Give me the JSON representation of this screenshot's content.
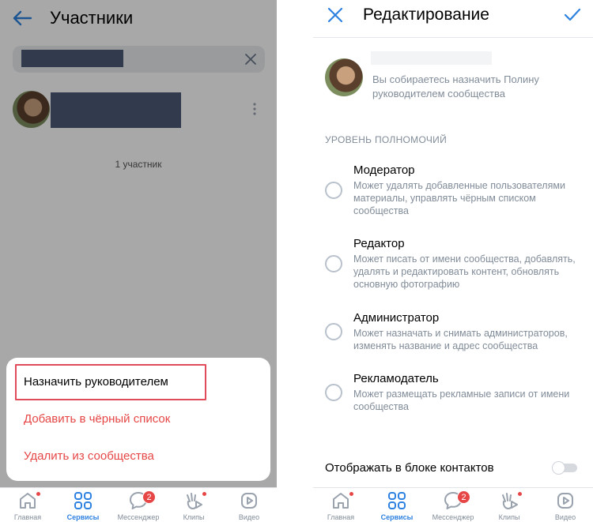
{
  "members_screen": {
    "title": "Участники",
    "count_text": "1 участник",
    "action_sheet": {
      "assign_label": "Назначить руководителем",
      "blacklist_label": "Добавить в чёрный список",
      "remove_label": "Удалить из сообщества"
    }
  },
  "edit_screen": {
    "title": "Редактирование",
    "info_text": "Вы собираетесь назначить Полину руководителем сообщества",
    "section_header": "УРОВЕНЬ ПОЛНОМОЧИЙ",
    "roles": [
      {
        "title": "Модератор",
        "description": "Может удалять добавленные пользователями материалы, управлять чёрным списком сообщества"
      },
      {
        "title": "Редактор",
        "description": "Может писать от имени сообщества, добавлять, удалять и редактировать контент, обновлять основную фотографию"
      },
      {
        "title": "Администратор",
        "description": "Может назначать и снимать администраторов, изменять название и адрес сообщества"
      },
      {
        "title": "Рекламодатель",
        "description": "Может размещать рекламные записи от имени сообщества"
      }
    ],
    "contacts_toggle_label": "Отображать в блоке контактов",
    "contacts_toggle_on": false
  },
  "tabbar": {
    "tabs": [
      {
        "label": "Главная",
        "icon": "home-icon",
        "dot": true
      },
      {
        "label": "Сервисы",
        "icon": "services-icon",
        "active": true
      },
      {
        "label": "Мессенджер",
        "icon": "messenger-icon",
        "badge": "2"
      },
      {
        "label": "Клипы",
        "icon": "clips-icon",
        "dot": true
      },
      {
        "label": "Видео",
        "icon": "video-icon"
      }
    ]
  },
  "colors": {
    "accent": "#2d81e0",
    "destructive": "#e64646",
    "secondary_text": "#818c99",
    "overlay": "rgba(0,0,0,0.34)",
    "redaction": "#4c5a75"
  }
}
